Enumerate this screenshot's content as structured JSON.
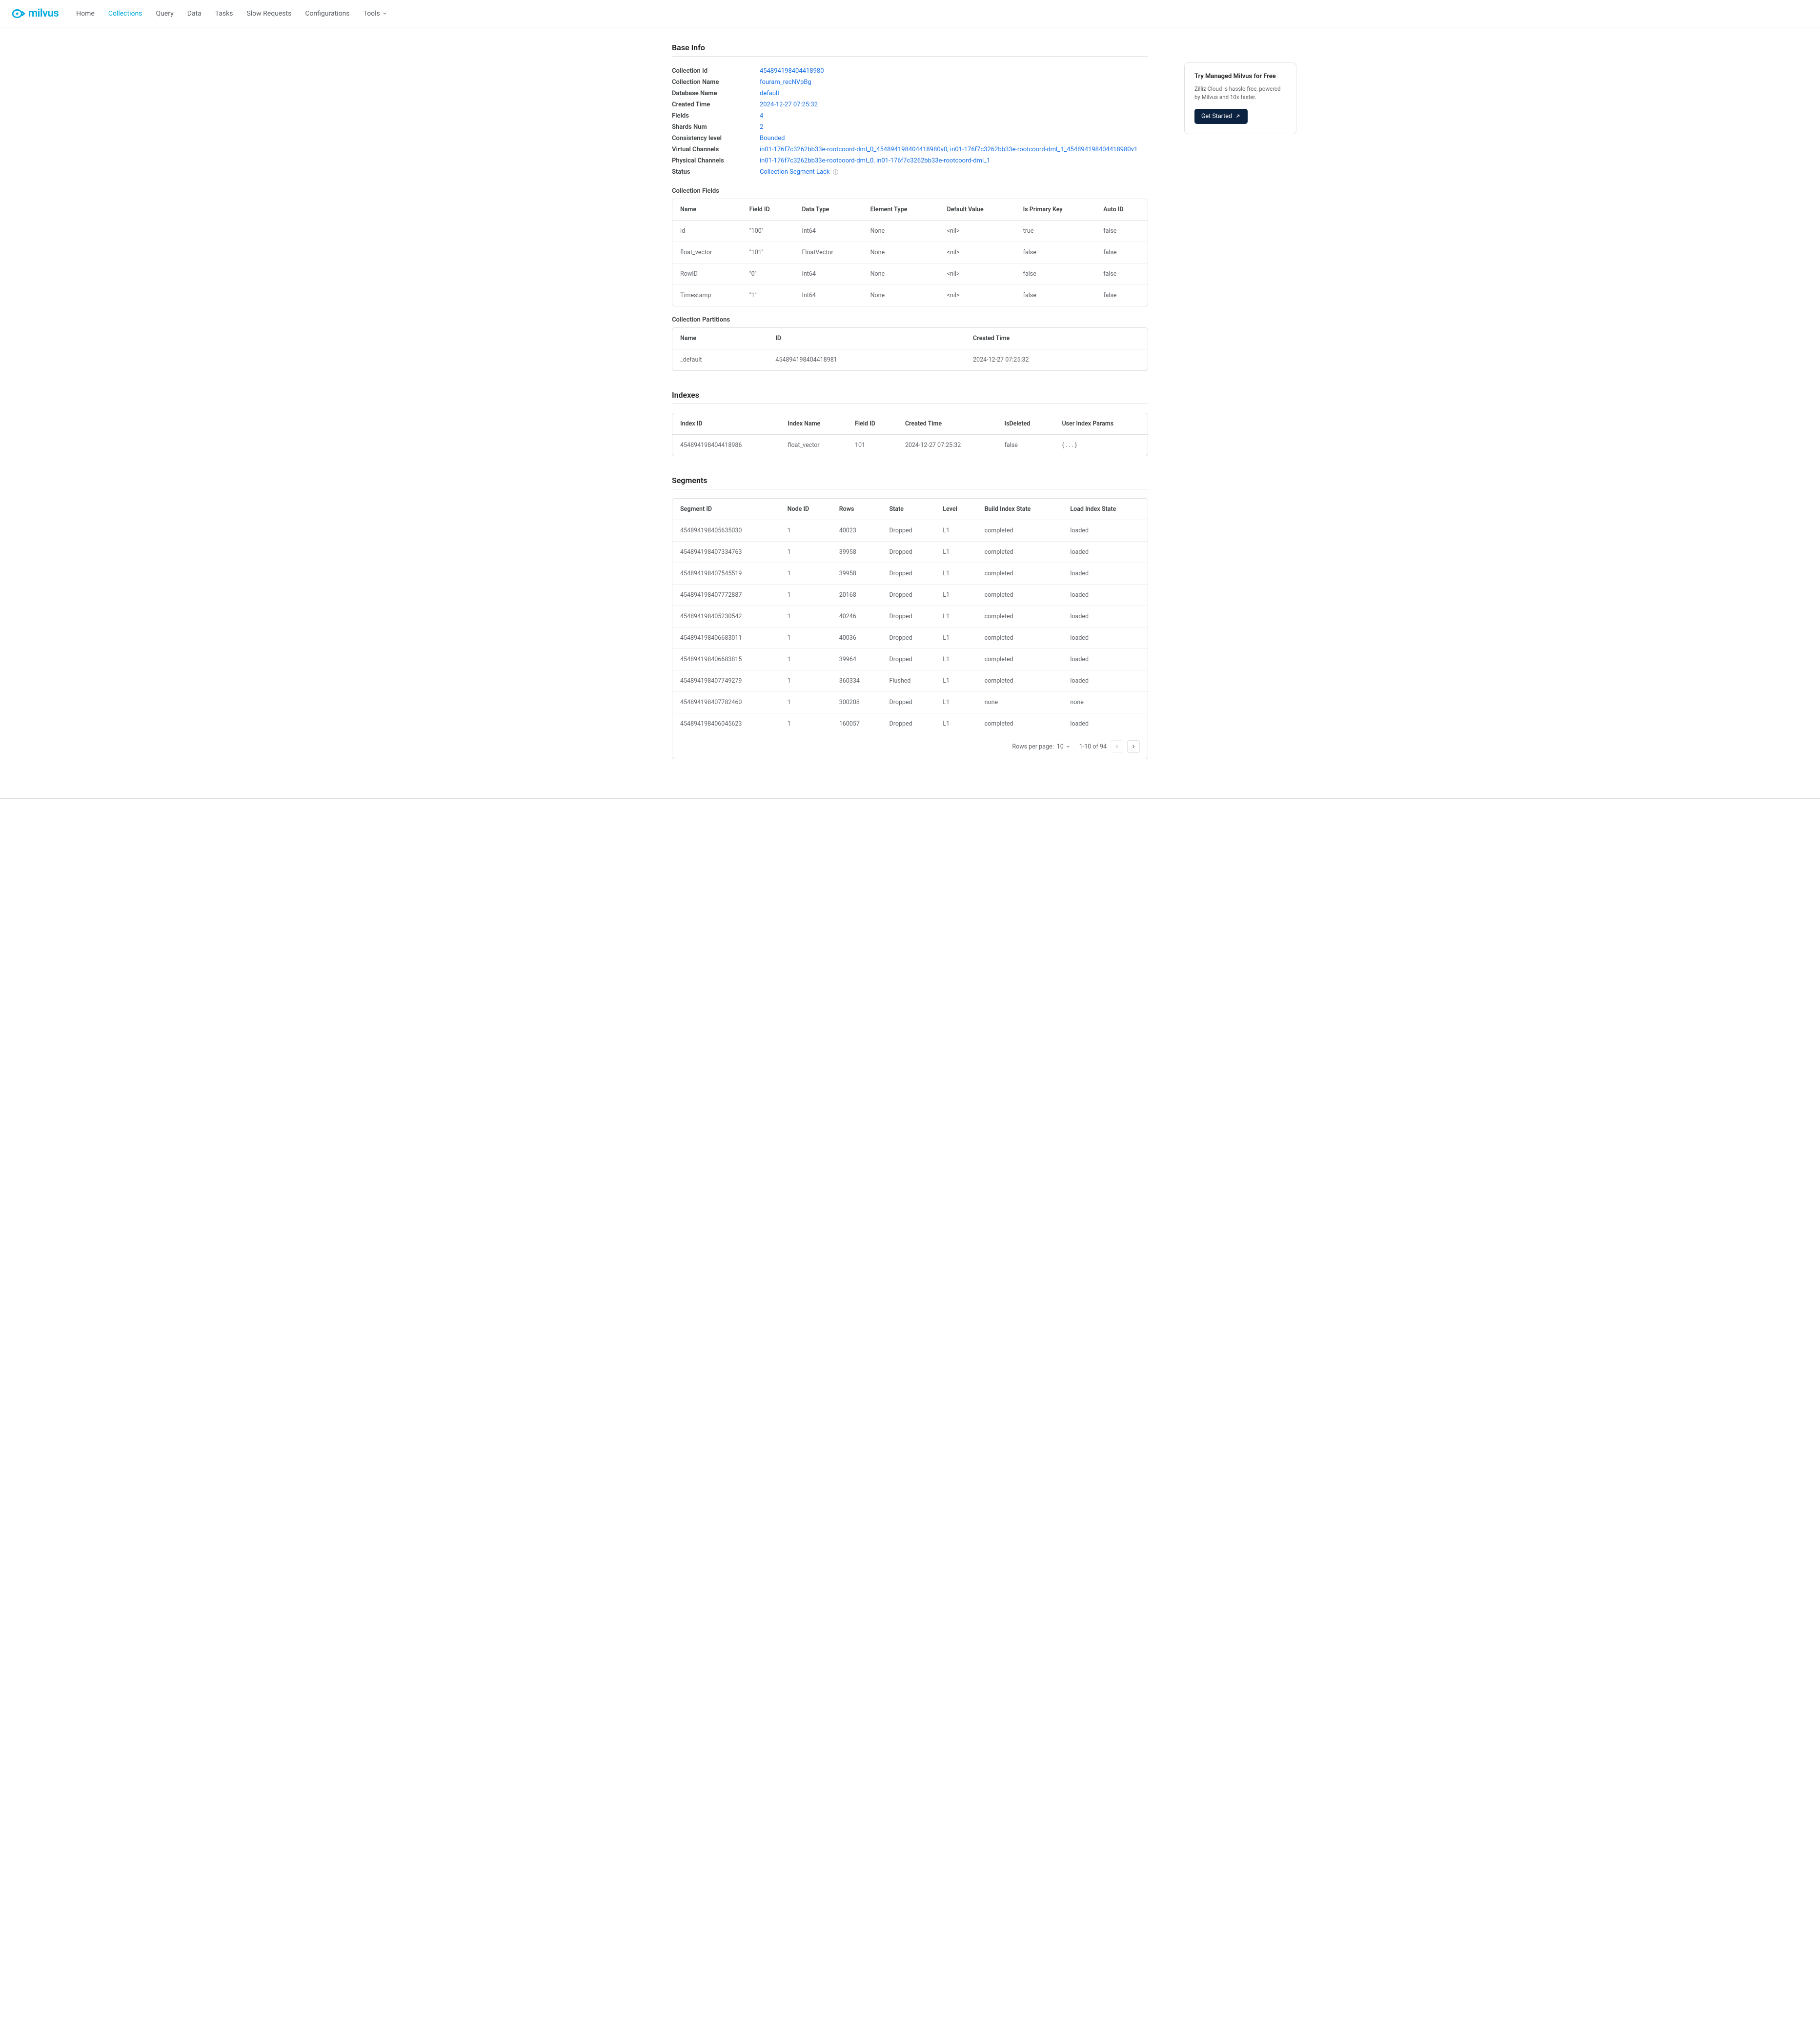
{
  "brand": "milvus",
  "nav": {
    "items": [
      "Home",
      "Collections",
      "Query",
      "Data",
      "Tasks",
      "Slow Requests",
      "Configurations",
      "Tools"
    ],
    "active_index": 1
  },
  "side_card": {
    "title": "Try Managed Milvus for Free",
    "desc": "Zilliz Cloud is hassle-free, powered by Milvus and 10x faster.",
    "button": "Get Started"
  },
  "sections": {
    "base_info": "Base Info",
    "indexes": "Indexes",
    "segments": "Segments",
    "collection_fields": "Collection Fields",
    "collection_partitions": "Collection Partitions"
  },
  "base_info": {
    "rows": [
      {
        "label": "Collection Id",
        "value": "454894198404418980"
      },
      {
        "label": "Collection Name",
        "value": "fouram_recNVpBg"
      },
      {
        "label": "Database Name",
        "value": "default"
      },
      {
        "label": "Created Time",
        "value": "2024-12-27 07:25:32"
      },
      {
        "label": "Fields",
        "value": "4"
      },
      {
        "label": "Shards Num",
        "value": "2"
      },
      {
        "label": "Consistency level",
        "value": "Bounded"
      },
      {
        "label": "Virtual Channels",
        "value": "in01-176f7c3262bb33e-rootcoord-dml_0_454894198404418980v0, in01-176f7c3262bb33e-rootcoord-dml_1_454894198404418980v1"
      },
      {
        "label": "Physical Channels",
        "value": "in01-176f7c3262bb33e-rootcoord-dml_0, in01-176f7c3262bb33e-rootcoord-dml_1"
      },
      {
        "label": "Status",
        "value": "Collection Segment Lack",
        "has_icon": true
      }
    ]
  },
  "fields_table": {
    "headers": [
      "Name",
      "Field ID",
      "Data Type",
      "Element Type",
      "Default Value",
      "Is Primary Key",
      "Auto ID"
    ],
    "rows": [
      {
        "name": "id",
        "field_id": "\"100\"",
        "data_type": "Int64",
        "element_type": "None",
        "default_value": "<nil>",
        "is_pk": "true",
        "auto_id": "false"
      },
      {
        "name": "float_vector",
        "field_id": "\"101\"",
        "data_type": "FloatVector",
        "element_type": "None",
        "default_value": "<nil>",
        "is_pk": "false",
        "auto_id": "false"
      },
      {
        "name": "RowID",
        "field_id": "\"0\"",
        "data_type": "Int64",
        "element_type": "None",
        "default_value": "<nil>",
        "is_pk": "false",
        "auto_id": "false"
      },
      {
        "name": "Timestamp",
        "field_id": "\"1\"",
        "data_type": "Int64",
        "element_type": "None",
        "default_value": "<nil>",
        "is_pk": "false",
        "auto_id": "false"
      }
    ]
  },
  "partitions_table": {
    "headers": [
      "Name",
      "ID",
      "Created Time"
    ],
    "rows": [
      {
        "name": "_default",
        "id": "454894198404418981",
        "created_time": "2024-12-27 07:25:32"
      }
    ]
  },
  "indexes_table": {
    "headers": [
      "Index ID",
      "Index Name",
      "Field ID",
      "Created Time",
      "IsDeleted",
      "User Index Params"
    ],
    "rows": [
      {
        "index_id": "454894198404418986",
        "index_name": "float_vector",
        "field_id": "101",
        "created_time": "2024-12-27 07:25:32",
        "is_deleted": "false",
        "params": "{ . . . }"
      }
    ]
  },
  "segments_table": {
    "headers": [
      "Segment ID",
      "Node ID",
      "Rows",
      "State",
      "Level",
      "Build Index State",
      "Load Index State"
    ],
    "rows": [
      {
        "segment_id": "454894198405635030",
        "node_id": "1",
        "rows": "40023",
        "state": "Dropped",
        "level": "L1",
        "build": "completed",
        "load": "loaded"
      },
      {
        "segment_id": "454894198407334763",
        "node_id": "1",
        "rows": "39958",
        "state": "Dropped",
        "level": "L1",
        "build": "completed",
        "load": "loaded"
      },
      {
        "segment_id": "454894198407545519",
        "node_id": "1",
        "rows": "39958",
        "state": "Dropped",
        "level": "L1",
        "build": "completed",
        "load": "loaded"
      },
      {
        "segment_id": "454894198407772887",
        "node_id": "1",
        "rows": "20168",
        "state": "Dropped",
        "level": "L1",
        "build": "completed",
        "load": "loaded"
      },
      {
        "segment_id": "454894198405230542",
        "node_id": "1",
        "rows": "40246",
        "state": "Dropped",
        "level": "L1",
        "build": "completed",
        "load": "loaded"
      },
      {
        "segment_id": "454894198406683011",
        "node_id": "1",
        "rows": "40036",
        "state": "Dropped",
        "level": "L1",
        "build": "completed",
        "load": "loaded"
      },
      {
        "segment_id": "454894198406683815",
        "node_id": "1",
        "rows": "39964",
        "state": "Dropped",
        "level": "L1",
        "build": "completed",
        "load": "loaded"
      },
      {
        "segment_id": "454894198407749279",
        "node_id": "1",
        "rows": "360334",
        "state": "Flushed",
        "level": "L1",
        "build": "completed",
        "load": "loaded"
      },
      {
        "segment_id": "454894198407782460",
        "node_id": "1",
        "rows": "300208",
        "state": "Dropped",
        "level": "L1",
        "build": "none",
        "load": "none"
      },
      {
        "segment_id": "454894198406045623",
        "node_id": "1",
        "rows": "160057",
        "state": "Dropped",
        "level": "L1",
        "build": "completed",
        "load": "loaded"
      }
    ]
  },
  "pagination": {
    "rows_per_page_label": "Rows per page:",
    "page_size": "10",
    "range": "1-10 of 94"
  }
}
